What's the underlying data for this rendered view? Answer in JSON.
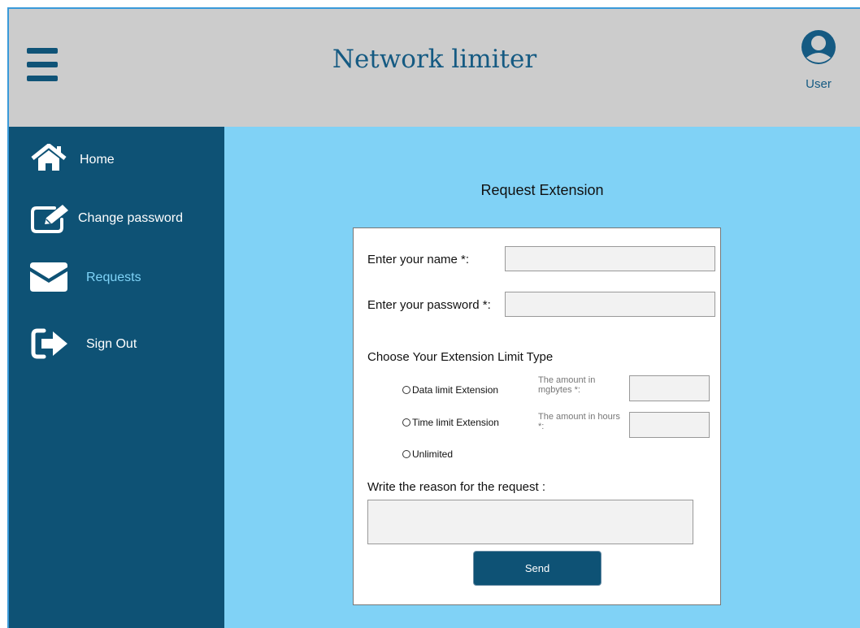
{
  "header": {
    "title": "Network limiter",
    "menu_icon": "hamburger-menu-icon",
    "user_label": "User",
    "user_icon": "user-avatar-icon"
  },
  "sidebar": {
    "items": [
      {
        "label": "Home",
        "icon": "home-icon",
        "active": false
      },
      {
        "label": "Change password",
        "icon": "edit-icon",
        "active": false
      },
      {
        "label": "Requests",
        "icon": "envelope-icon",
        "active": true
      },
      {
        "label": "Sign Out",
        "icon": "sign-out-icon",
        "active": false
      }
    ]
  },
  "page": {
    "title": "Request Extension"
  },
  "form": {
    "name_label": "Enter your name *:",
    "name_value": "",
    "password_label": "Enter your password *:",
    "password_value": "",
    "limit_type_label": "Choose Your Extension Limit Type",
    "options": [
      {
        "label": "Data limit Extension",
        "amount_label": "The amount in mgbytes *:",
        "amount_value": ""
      },
      {
        "label": "Time limit Extension",
        "amount_label": "The amount in hours *:",
        "amount_value": ""
      },
      {
        "label": "Unlimited"
      }
    ],
    "reason_label": "Write the reason for the request :",
    "reason_value": "",
    "send_label": "Send"
  },
  "colors": {
    "header_bg": "#cccccc",
    "sidebar_bg": "#0e5275",
    "main_bg": "#80d2f6",
    "title_text": "#155a82",
    "active_nav_text": "#7fd3f7",
    "button_bg": "#0e5275"
  }
}
